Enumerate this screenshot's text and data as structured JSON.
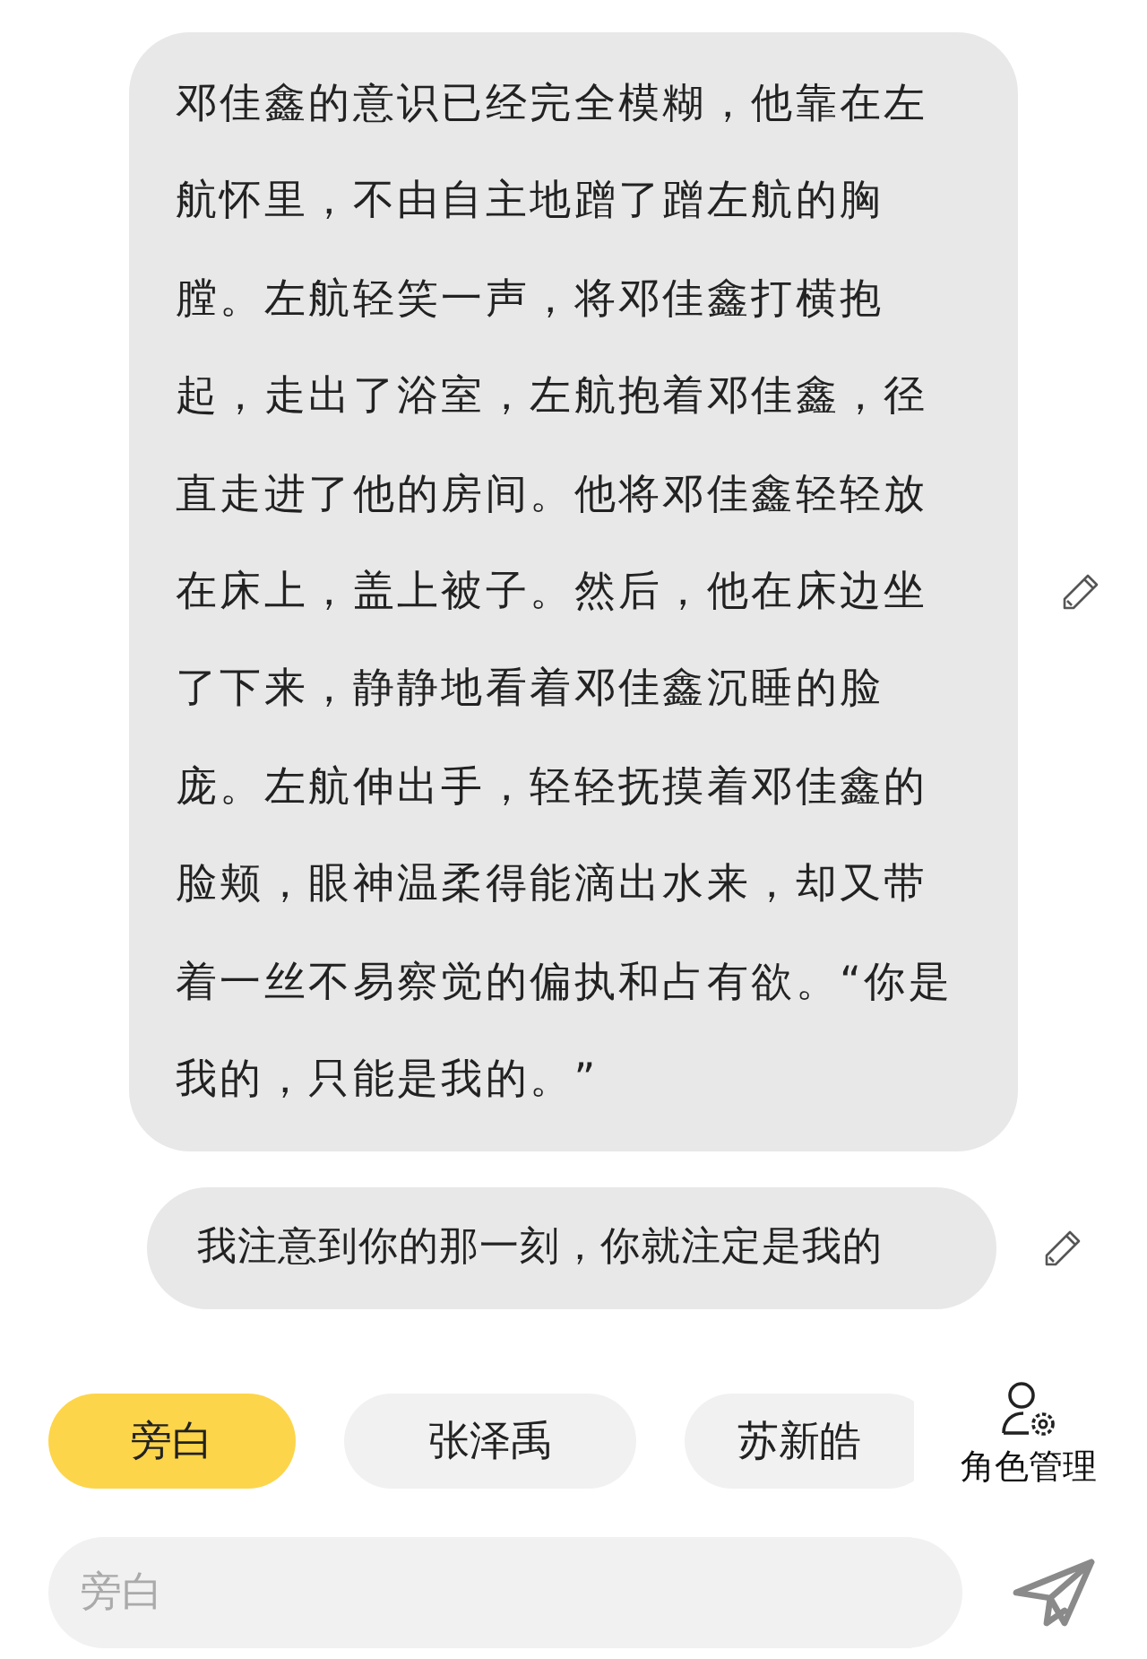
{
  "messages": [
    {
      "text": "邓佳鑫的意识已经完全模糊，他靠在左航怀里，不由自主地蹭了蹭左航的胸膛。左航轻笑一声，将邓佳鑫打横抱起，走出了浴室，左航抱着邓佳鑫，径直走进了他的房间。他将邓佳鑫轻轻放在床上，盖上被子。然后，他在床边坐了下来，静静地看着邓佳鑫沉睡的脸庞。左航伸出手，轻轻抚摸着邓佳鑫的脸颊，眼神温柔得能滴出水来，却又带着一丝不易察觉的偏执和占有欲。“你是我的，只能是我的。”"
    },
    {
      "text": "我注意到你的那一刻，你就注定是我的"
    }
  ],
  "roles": [
    {
      "label": "旁白",
      "selected": true
    },
    {
      "label": "张泽禹",
      "selected": false
    },
    {
      "label": "苏新皓",
      "selected": false
    }
  ],
  "role_manager": {
    "label": "角色管理"
  },
  "input": {
    "placeholder": "旁白"
  }
}
